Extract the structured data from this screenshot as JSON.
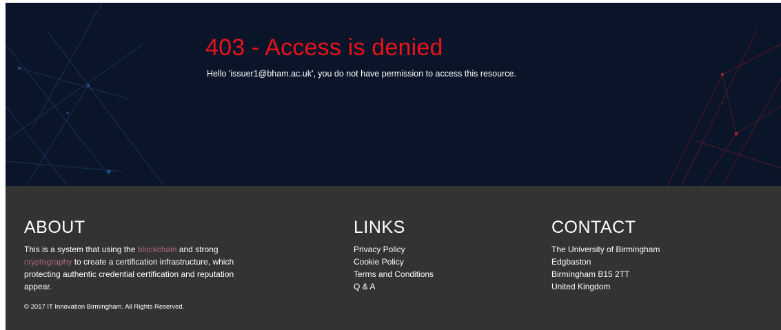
{
  "hero": {
    "title": "403 - Access is denied",
    "message": "Hello 'issuer1@bham.ac.uk', you do not have permission to access this resource."
  },
  "footer": {
    "about": {
      "heading": "ABOUT",
      "text_1": "This is a system that using the ",
      "link_1": "blockchain",
      "text_2": " and strong ",
      "link_2": "cryptography",
      "text_3": " to create a certification infrastructure, which protecting authentic credential certification and reputation appear."
    },
    "links": {
      "heading": "LINKS",
      "items": [
        "Privacy Policy",
        "Cookie Policy",
        "Terms and Conditions",
        "Q & A"
      ]
    },
    "contact": {
      "heading": "CONTACT",
      "lines": [
        "The University of Birmingham",
        "Edgbaston",
        "Birmingham B15 2TT",
        "United Kingdom"
      ]
    },
    "copyright": "© 2017 IT Innovation Birmingham. All Rights Reserved."
  },
  "colors": {
    "hero_bg": "#0b1529",
    "title_red": "#e8131b",
    "footer_bg": "#333333",
    "link_accent": "#b06a7a"
  }
}
